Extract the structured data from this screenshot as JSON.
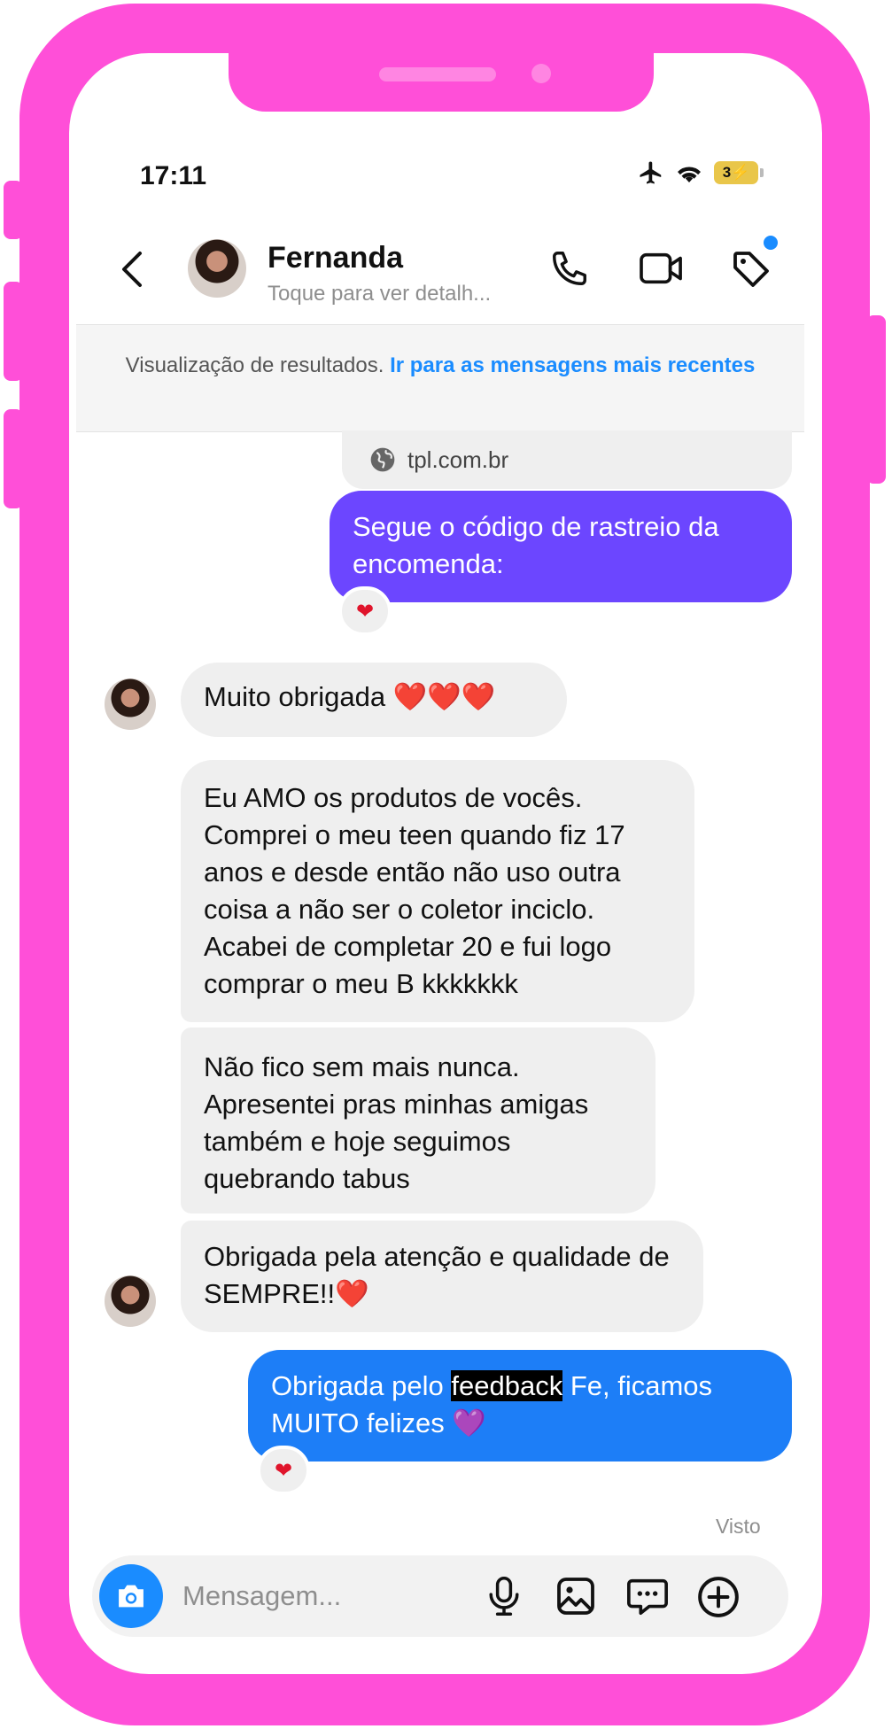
{
  "status": {
    "time": "17:11",
    "battery": "3⚡"
  },
  "header": {
    "name": "Fernanda",
    "subtitle": "Toque para ver detalh...",
    "icons": [
      "back-chevron-icon",
      "phone-icon",
      "video-camera-icon",
      "tag-icon"
    ]
  },
  "banner": {
    "text": "Visualização de resultados.",
    "link": "Ir para as mensagens mais recentes"
  },
  "link_preview": {
    "domain": "tpl.com.br"
  },
  "messages": [
    {
      "from": "me",
      "text": "Segue o código de rastreio da encomenda:",
      "reaction": "❤"
    },
    {
      "from": "Fernanda",
      "text": "Muito obrigada ❤️❤️❤️"
    },
    {
      "from": "Fernanda",
      "text": "Eu AMO os produtos de vocês. Comprei o meu teen quando fiz 17 anos e desde então não uso outra coisa a não ser o coletor inciclo. Acabei de completar 20 e fui logo comprar o meu B kkkkkkk"
    },
    {
      "from": "Fernanda",
      "text": "Não fico sem mais nunca. Apresentei pras minhas amigas também e hoje seguimos quebrando tabus"
    },
    {
      "from": "Fernanda",
      "text": "Obrigada pela atenção e qualidade de SEMPRE!!❤️"
    },
    {
      "from": "me",
      "text_before": "Obrigada pelo ",
      "text_highlight": "feedback",
      "text_after": " Fe, ficamos MUITO felizes 💜",
      "reaction": "❤"
    }
  ],
  "seen_label": "Visto",
  "composer": {
    "placeholder": "Mensagem...",
    "icons": [
      "camera-icon",
      "microphone-icon",
      "image-icon",
      "sticker-chat-icon",
      "plus-circle-icon"
    ]
  },
  "colors": {
    "frame": "#ff4fd8",
    "outgoing_purple": "#6c46ff",
    "outgoing_blue": "#1d7ef7",
    "accent": "#1a8cff"
  }
}
